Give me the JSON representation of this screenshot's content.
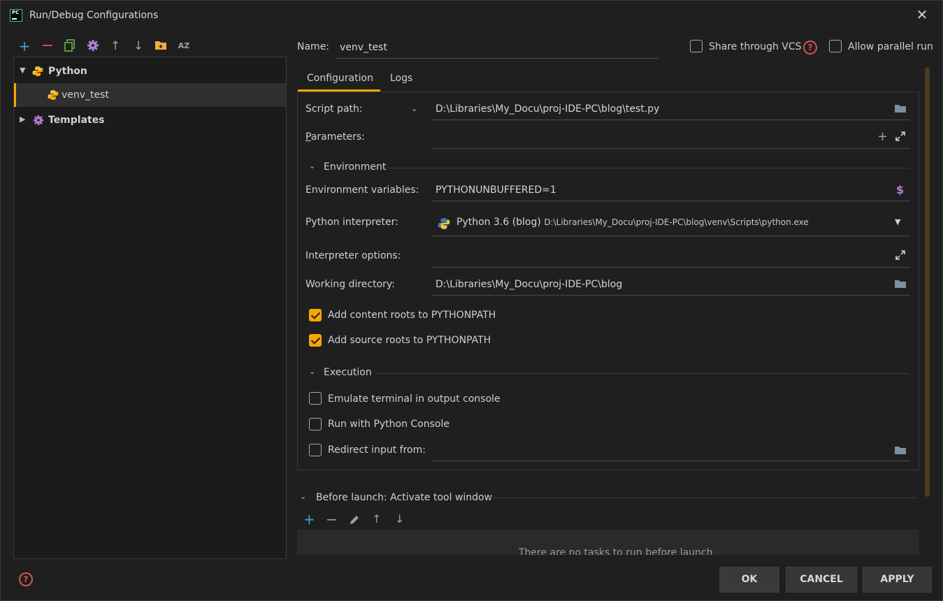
{
  "window": {
    "title": "Run/Debug Configurations",
    "app_icon_text": "PC"
  },
  "toolbar": {
    "icons": [
      "add-icon",
      "remove-icon",
      "copy-icon",
      "settings-icon",
      "move-up-icon",
      "move-down-icon",
      "new-folder-icon",
      "sort-alpha-icon"
    ],
    "sort_text": "AZ"
  },
  "tree": {
    "python": "Python",
    "venv_test": "venv_test",
    "templates": "Templates"
  },
  "header": {
    "name_label": "Name:",
    "name_value": "venv_test",
    "share_vcs": "Share through VCS",
    "allow_parallel": "Allow parallel run"
  },
  "tabs": [
    "Configuration",
    "Logs"
  ],
  "form": {
    "script_path_label": "Script path:",
    "script_path_value": "D:\\Libraries\\My_Docu\\proj-IDE-PC\\blog\\test.py",
    "parameters_label": "Parameters:",
    "environment_section": "Environment",
    "env_vars_label": "Environment variables:",
    "env_vars_value": "PYTHONUNBUFFERED=1",
    "interpreter_label": "Python interpreter:",
    "interpreter_name": "Python 3.6 (blog)",
    "interpreter_path": "D:\\Libraries\\My_Docu\\proj-IDE-PC\\blog\\venv\\Scripts\\python.exe",
    "interp_options_label": "Interpreter options:",
    "working_dir_label": "Working directory:",
    "working_dir_value": "D:\\Libraries\\My_Docu\\proj-IDE-PC\\blog",
    "add_content_roots": "Add content roots to PYTHONPATH",
    "add_source_roots": "Add source roots to PYTHONPATH",
    "execution_section": "Execution",
    "emulate_terminal": "Emulate terminal in output console",
    "run_python_console": "Run with Python Console",
    "redirect_input": "Redirect input from:"
  },
  "checkboxes": {
    "share_vcs": false,
    "allow_parallel": false,
    "add_content_roots": true,
    "add_source_roots": true,
    "emulate_terminal": false,
    "run_python_console": false,
    "redirect_input": false
  },
  "before_launch": {
    "title": "Before launch: Activate tool window",
    "empty_text": "There are no tasks to run before launch"
  },
  "buttons": {
    "ok": "OK",
    "cancel": "CANCEL",
    "apply": "APPLY"
  },
  "colors": {
    "accent": "#f7a800",
    "add": "#3da6e0",
    "remove": "#e05555",
    "copy": "#6ab04c",
    "settings": "#b07ed6",
    "help": "#d9534f"
  }
}
